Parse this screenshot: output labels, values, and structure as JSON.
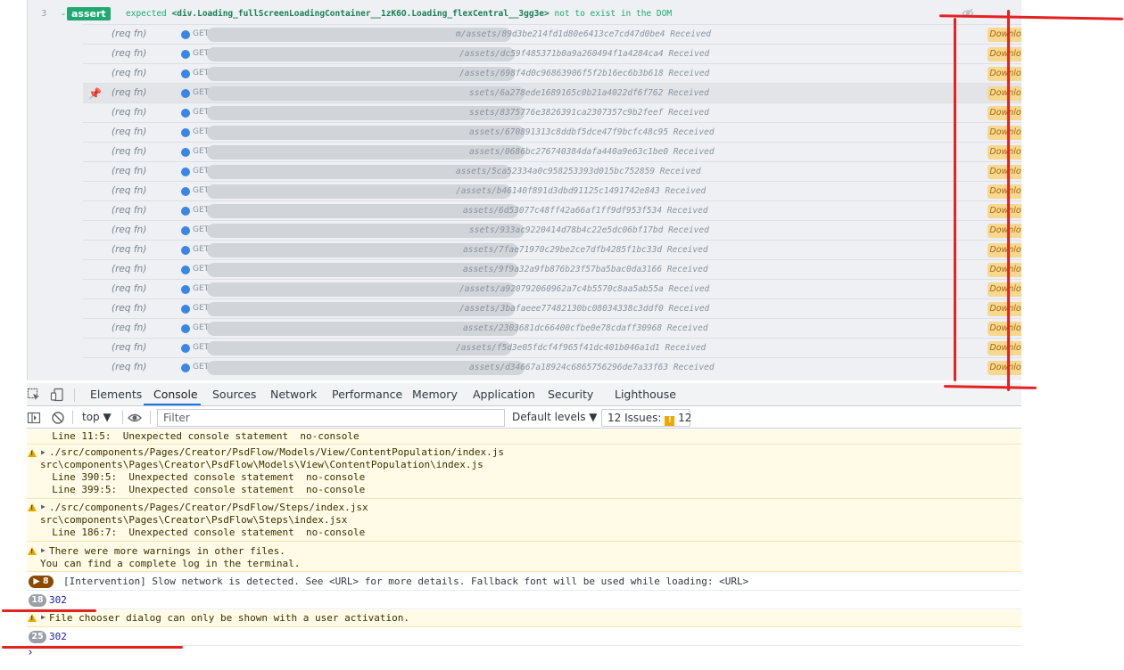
{
  "cypress": {
    "assert_row": {
      "number": "3",
      "badge": "assert",
      "expected_label": "expected",
      "element": "<div.Loading_fullScreenLoadingContainer__1zK6O.Loading_flexCentral__3gg3e>",
      "suffix": "not to exist in the DOM",
      "eye_icon": "eye-slash-icon"
    },
    "req_label": "(req fn)",
    "method": "GET",
    "status_word": "Received",
    "download_label": "Download",
    "requests": [
      {
        "path": "m/assets/89d3be214fd1d80e6413ce7cd47d0be4"
      },
      {
        "path": "/assets/dc59f485371b0a9a260494f1a4284ca4"
      },
      {
        "path": "/assets/698f4d0c96863906f5f2b16ec6b3b618"
      },
      {
        "path": "ssets/6a278ede1689165c0b21a4022df6f762",
        "pinned": true
      },
      {
        "path": "ssets/8375776e3826391ca2307357c9b2feef"
      },
      {
        "path": "assets/670891313c8ddbf5dce47f9bcfc48c95"
      },
      {
        "path": "assets/0686bc276740384dafa440a9e63c1be0"
      },
      {
        "path": "assets/5ca52334a0c958253393d015bc752859"
      },
      {
        "path": "/assets/b46140f891d3dbd91125c1491742e843"
      },
      {
        "path": "assets/6d53077c48ff42a66af1ff9df953f534"
      },
      {
        "path": "ssets/933ac9220414d78b4c22e5dc06bf17bd"
      },
      {
        "path": "assets/7fae71970c29be2ce7dfb4285f1bc33d"
      },
      {
        "path": "assets/9f9a32a9fb876b23f57ba5bac0da3166"
      },
      {
        "path": "/assets/a920792060962a7c4b5570c8aa5ab55a"
      },
      {
        "path": "/assets/3bafaeee77482130bc08034338c3ddf0"
      },
      {
        "path": "assets/2303681dc66400cfbe0e78cdaff30968"
      },
      {
        "path": "/assets/f5d3e05fdcf4f965f41dc401b046a1d1"
      },
      {
        "path": "assets/d34667a18924c6865756296de7a33f63"
      }
    ]
  },
  "devtools": {
    "tabs": [
      "Elements",
      "Console",
      "Sources",
      "Network",
      "Performance",
      "Memory",
      "Application",
      "Security",
      "Lighthouse"
    ],
    "active_tab": "Console",
    "toolbar": {
      "context": "top ▼",
      "filter_placeholder": "Filter",
      "levels": "Default levels ▼",
      "issues_label": "12 Issues:",
      "issues_count": "12"
    }
  },
  "console": {
    "top_line": "  Line 11:5:  Unexpected console statement  no-console",
    "warn1": {
      "file": "./src/components/Pages/Creator/PsdFlow/Models/View/ContentPopulation/index.js",
      "path": "src\\components\\Pages\\Creator\\PsdFlow\\Models\\View\\ContentPopulation\\index.js",
      "lines": [
        "  Line 390:5:  Unexpected console statement  no-console",
        "  Line 399:5:  Unexpected console statement  no-console"
      ]
    },
    "warn2": {
      "file": "./src/components/Pages/Creator/PsdFlow/Steps/index.jsx",
      "path": "src\\components\\Pages\\Creator\\PsdFlow\\Steps\\index.jsx",
      "lines": [
        "  Line 186:7:  Unexpected console statement  no-console"
      ]
    },
    "warn3": {
      "text": "There were more warnings in other files.",
      "text2": "You can find a complete log in the terminal."
    },
    "intervention": {
      "count": "▶ 8",
      "text": "[Intervention] Slow network is detected. See <URL> for more details. Fallback font will be used while loading: <URL>"
    },
    "log1": {
      "count": "18",
      "value": "302"
    },
    "warn4": {
      "text": "File chooser dialog can only be shown with a user activation."
    },
    "log2": {
      "count": "25",
      "value": "302"
    },
    "prompt": "›"
  },
  "colors": {
    "annotation_red": "#e52222",
    "assert_green": "#1fa971",
    "download_bg": "#f8d78f",
    "warning_bg": "#fffbe6"
  }
}
